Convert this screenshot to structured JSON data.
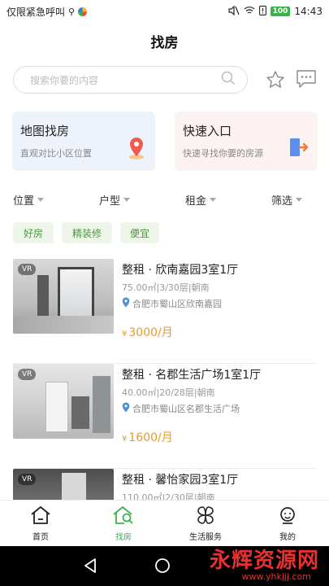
{
  "status_bar": {
    "left_text": "仅限紧急呼叫",
    "battery": "100",
    "time": "14:43"
  },
  "header": {
    "title": "找房"
  },
  "search": {
    "placeholder": "搜索你要的内容"
  },
  "cards": [
    {
      "title": "地图找房",
      "subtitle": "直观对比小区位置",
      "icon": "location-pin-icon"
    },
    {
      "title": "快速入口",
      "subtitle": "快速寻找你要的房源",
      "icon": "exit-door-icon"
    }
  ],
  "filters": [
    "位置",
    "户型",
    "租金",
    "筛选"
  ],
  "tags": [
    "好房",
    "精装修",
    "便宜"
  ],
  "listings": [
    {
      "vr": "VR",
      "title": "整租 · 欣南嘉园3室1厅",
      "info": "75.00㎡|3/30层|朝南",
      "location": "合肥市蜀山区欣南嘉园",
      "currency": "¥",
      "price": "3000/月"
    },
    {
      "vr": "VR",
      "title": "整租 · 名郡生活广场1室1厅",
      "info": "40.00㎡|20/28层|朝南",
      "location": "合肥市蜀山区名郡生活广场",
      "currency": "¥",
      "price": "1600/月"
    },
    {
      "vr": "VR",
      "title": "整租 · 馨怡家园3室1厅",
      "info": "110.00㎡|2/30层|朝南",
      "location": "",
      "currency": "",
      "price": ""
    }
  ],
  "tabbar": [
    {
      "label": "首页",
      "icon": "home-icon",
      "active": false
    },
    {
      "label": "找房",
      "icon": "find-house-icon",
      "active": true
    },
    {
      "label": "生活服务",
      "icon": "services-icon",
      "active": false
    },
    {
      "label": "我的",
      "icon": "profile-icon",
      "active": false
    }
  ],
  "watermark": {
    "text": "永辉资源网",
    "url": "www.yhkjjj.com"
  },
  "colors": {
    "accent_green": "#3cb34a",
    "price_orange": "#e79a2c",
    "tag_bg": "#eef6ea",
    "map_card_bg": "#eef3fb",
    "quick_card_bg": "#fbf2f1"
  }
}
